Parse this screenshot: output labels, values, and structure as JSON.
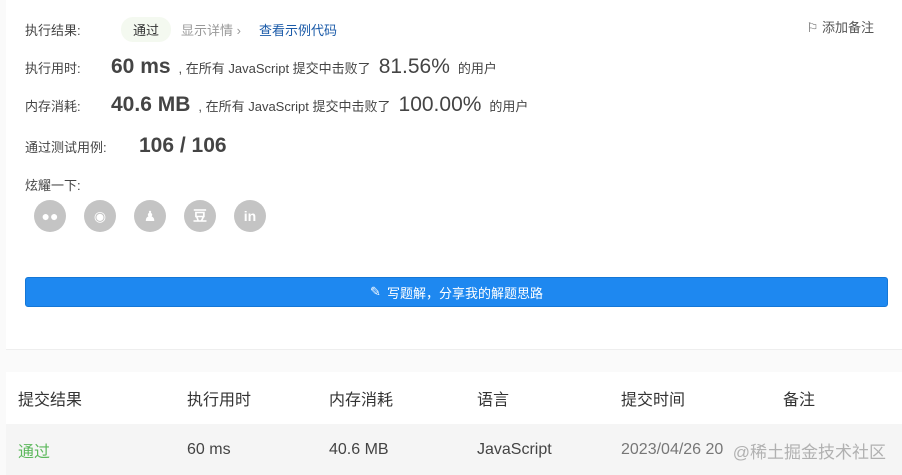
{
  "result": {
    "label": "执行结果:",
    "status": "通过",
    "detail": "显示详情 ›",
    "sample": "查看示例代码",
    "add_note": "添加备注"
  },
  "runtime": {
    "label": "执行用时:",
    "value": "60 ms",
    "text": ", 在所有 JavaScript 提交中击败了",
    "percent": "81.56%",
    "suffix": "的用户"
  },
  "memory": {
    "label": "内存消耗:",
    "value": "40.6 MB",
    "text": ", 在所有 JavaScript 提交中击败了",
    "percent": "100.00%",
    "suffix": "的用户"
  },
  "tests": {
    "label": "通过测试用例:",
    "value": "106 / 106"
  },
  "share": {
    "label": "炫耀一下:",
    "icons": [
      "wechat-icon",
      "weibo-icon",
      "qq-icon",
      "douban-icon",
      "linkedin-icon"
    ]
  },
  "write_button": "写题解，分享我的解题思路",
  "table": {
    "headers": [
      "提交结果",
      "执行用时",
      "内存消耗",
      "语言",
      "提交时间",
      "备注"
    ],
    "rows": [
      {
        "status": "通过",
        "runtime": "60 ms",
        "memory": "40.6 MB",
        "lang": "JavaScript",
        "time": "2023/04/26 20"
      }
    ]
  },
  "watermark": "@稀土掘金技术社区",
  "colors": {
    "accent": "#1e88f0",
    "pass": "#5cb85c"
  }
}
